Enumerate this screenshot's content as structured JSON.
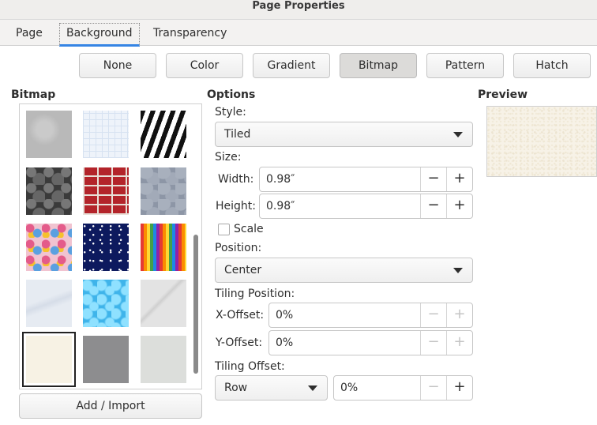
{
  "window": {
    "title": "Page Properties"
  },
  "tabs": [
    {
      "label": "Page"
    },
    {
      "label": "Background",
      "active": true
    },
    {
      "label": "Transparency"
    }
  ],
  "fill_types": [
    {
      "label": "None"
    },
    {
      "label": "Color"
    },
    {
      "label": "Gradient"
    },
    {
      "label": "Bitmap",
      "pressed": true
    },
    {
      "label": "Pattern"
    },
    {
      "label": "Hatch"
    }
  ],
  "bitmap": {
    "title": "Bitmap",
    "add_import_label": "Add / Import",
    "selected_index": 12,
    "tiles": [
      {
        "icon": "gray-noise-texture",
        "color": "#b9b9b9"
      },
      {
        "icon": "grid-paper-texture",
        "color": "#eef3fa"
      },
      {
        "icon": "zebra-texture",
        "color": "#1a1a1a"
      },
      {
        "icon": "dark-stone-texture",
        "color": "#3a3a3a"
      },
      {
        "icon": "red-brick-texture",
        "color": "#b3242a"
      },
      {
        "icon": "gray-stone-wall-texture",
        "color": "#8d96a6"
      },
      {
        "icon": "floral-texture",
        "color": "#f1c3d0"
      },
      {
        "icon": "night-sky-texture",
        "color": "#0d1a5e"
      },
      {
        "icon": "color-pencils-texture",
        "color": "#e0a000"
      },
      {
        "icon": "white-fabric-texture",
        "color": "#e6ebf2"
      },
      {
        "icon": "water-texture",
        "color": "#3fb4ea"
      },
      {
        "icon": "white-marble-texture",
        "color": "#e3e3e3"
      },
      {
        "icon": "cream-paper-texture",
        "color": "#f7f2e4"
      },
      {
        "icon": "gray-cloth-texture",
        "color": "#8d8d8f"
      },
      {
        "icon": "light-gray-texture",
        "color": "#dcdedb"
      }
    ]
  },
  "options": {
    "title": "Options",
    "style_label": "Style:",
    "style_value": "Tiled",
    "size_label": "Size:",
    "width_label": "Width:",
    "width_value": "0.98″",
    "height_label": "Height:",
    "height_value": "0.98″",
    "scale_label": "Scale",
    "scale_checked": false,
    "position_label": "Position:",
    "position_value": "Center",
    "tiling_position_label": "Tiling Position:",
    "x_offset_label": "X-Offset:",
    "x_offset_value": "0%",
    "y_offset_label": "Y-Offset:",
    "y_offset_value": "0%",
    "tiling_offset_label": "Tiling Offset:",
    "tiling_offset_mode": "Row",
    "tiling_offset_value": "0%",
    "minus": "−",
    "plus": "+"
  },
  "preview": {
    "title": "Preview",
    "color": "#f7f2e7"
  }
}
